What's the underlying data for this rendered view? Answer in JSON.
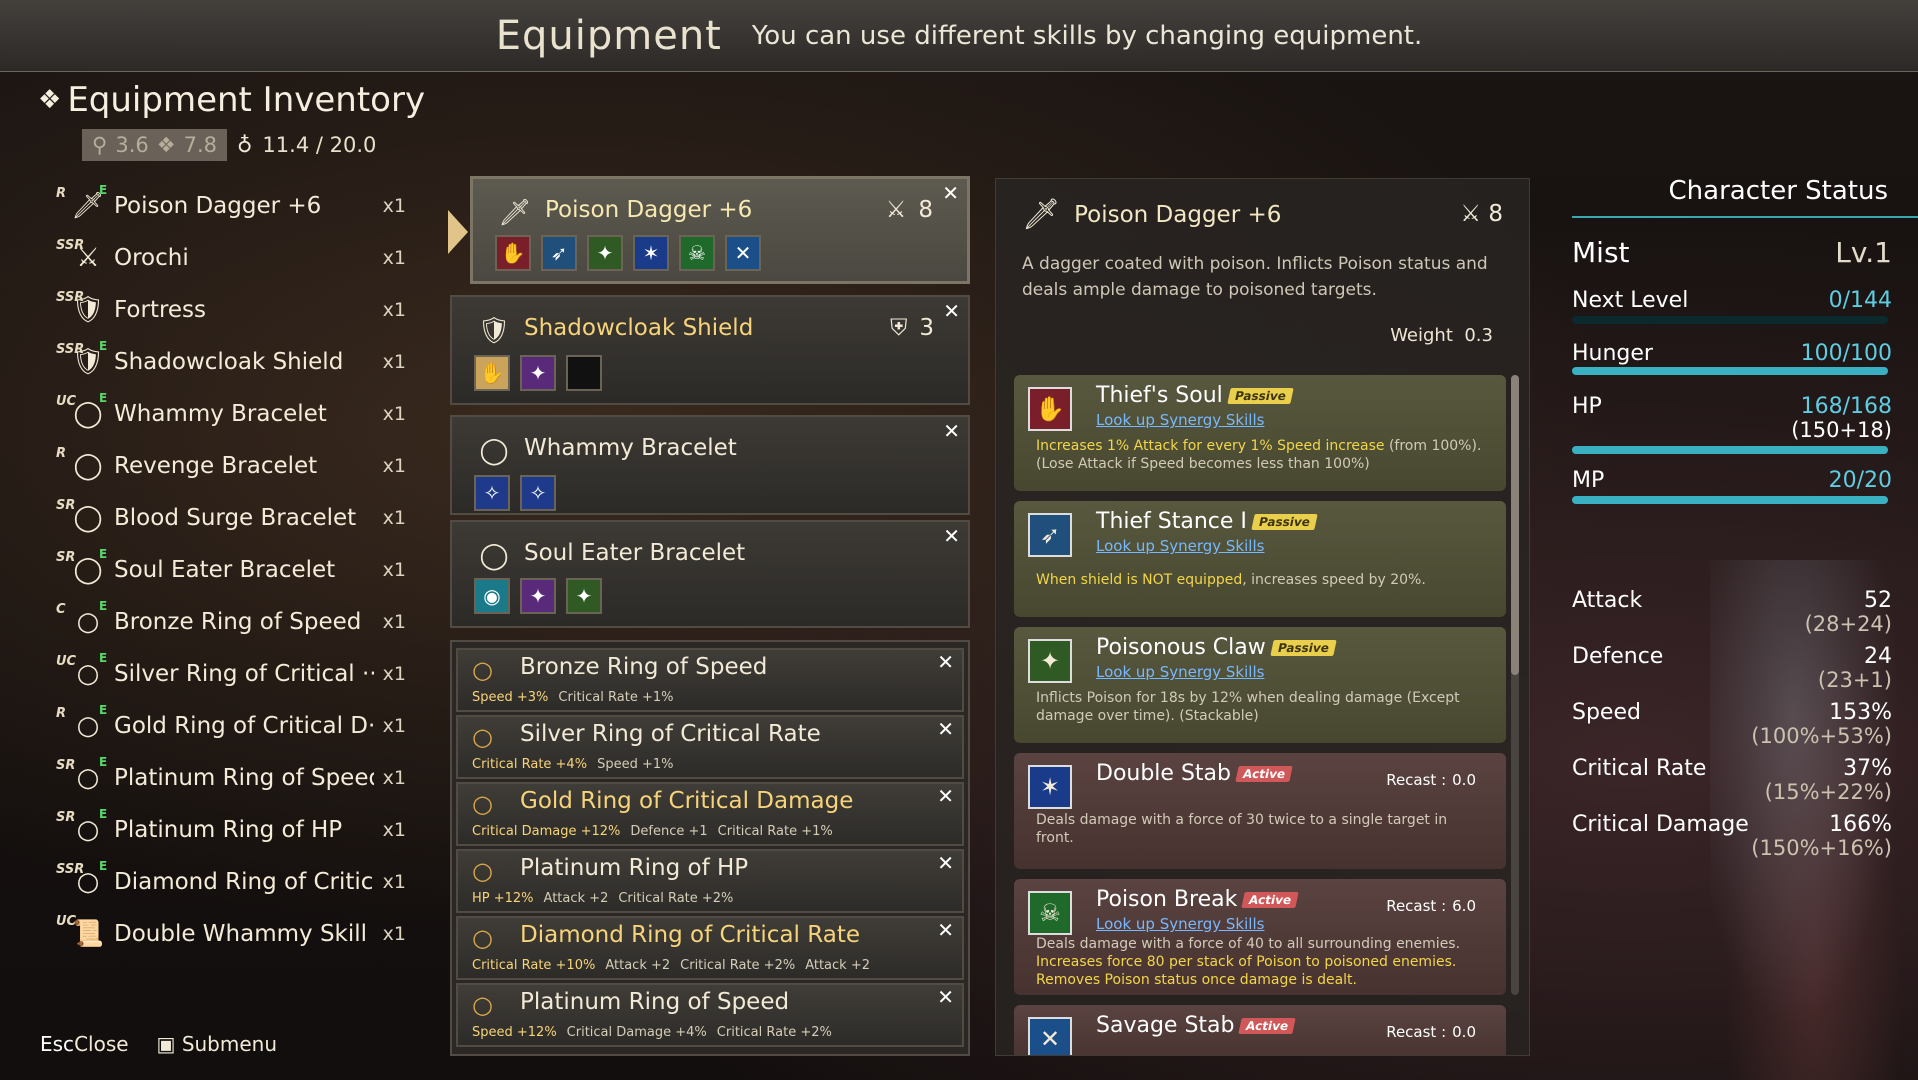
{
  "header": {
    "title": "Equipment",
    "subtitle": "You can use different skills by changing equipment."
  },
  "inventory": {
    "title": "Equipment Inventory",
    "stat_a": "3.6",
    "stat_b": "7.8",
    "weight": "11.4 / 20.0",
    "items": [
      {
        "rarity": "R",
        "equipped": "E",
        "icon": "dagger-icon",
        "glyph": "🗡",
        "name": "Poison Dagger +6",
        "qty": "x1"
      },
      {
        "rarity": "SSR",
        "equipped": "",
        "icon": "sword-icon",
        "glyph": "⚔",
        "name": "Orochi",
        "qty": "x1"
      },
      {
        "rarity": "SSR",
        "equipped": "",
        "icon": "shield-icon",
        "glyph": "🛡",
        "name": "Fortress",
        "qty": "x1"
      },
      {
        "rarity": "SSR",
        "equipped": "E",
        "icon": "shield-icon",
        "glyph": "🛡",
        "name": "Shadowcloak Shield",
        "qty": "x1"
      },
      {
        "rarity": "UC",
        "equipped": "E",
        "icon": "bracelet-icon",
        "glyph": "◯",
        "name": "Whammy Bracelet",
        "qty": "x1"
      },
      {
        "rarity": "R",
        "equipped": "",
        "icon": "bracelet-icon",
        "glyph": "◯",
        "name": "Revenge Bracelet",
        "qty": "x1"
      },
      {
        "rarity": "SR",
        "equipped": "",
        "icon": "bracelet-icon",
        "glyph": "◯",
        "name": "Blood Surge Bracelet",
        "qty": "x1"
      },
      {
        "rarity": "SR",
        "equipped": "E",
        "icon": "bracelet-icon",
        "glyph": "◯",
        "name": "Soul Eater Bracelet",
        "qty": "x1"
      },
      {
        "rarity": "C",
        "equipped": "E",
        "icon": "ring-icon",
        "glyph": "○",
        "name": "Bronze Ring of Speed",
        "qty": "x1"
      },
      {
        "rarity": "UC",
        "equipped": "E",
        "icon": "ring-icon",
        "glyph": "○",
        "name": "Silver Ring of Critical ···",
        "qty": "x1"
      },
      {
        "rarity": "R",
        "equipped": "E",
        "icon": "ring-icon",
        "glyph": "○",
        "name": "Gold Ring of Critical D···",
        "qty": "x1"
      },
      {
        "rarity": "SR",
        "equipped": "E",
        "icon": "ring-icon",
        "glyph": "○",
        "name": "Platinum Ring of Speed",
        "qty": "x1"
      },
      {
        "rarity": "SR",
        "equipped": "E",
        "icon": "ring-icon",
        "glyph": "○",
        "name": "Platinum Ring of HP",
        "qty": "x1"
      },
      {
        "rarity": "SSR",
        "equipped": "E",
        "icon": "ring-icon",
        "glyph": "○",
        "name": "Diamond Ring of Critic···",
        "qty": "x1"
      },
      {
        "rarity": "UC",
        "equipped": "",
        "icon": "scroll-icon",
        "glyph": "📜",
        "name": "Double Whammy Skill ···",
        "qty": "x1"
      }
    ]
  },
  "footer": {
    "close_key": "Esc",
    "close_label": "Close",
    "submenu_label": "Submenu"
  },
  "equipped": {
    "weapon": {
      "name": "Poison Dagger +6",
      "power": "8"
    },
    "shield": {
      "name": "Shadowcloak Shield",
      "defence": "3"
    },
    "bracelet1": {
      "name": "Whammy Bracelet"
    },
    "bracelet2": {
      "name": "Soul Eater Bracelet"
    },
    "rings": [
      {
        "name": "Bronze Ring of Speed",
        "gold": false,
        "desc": [
          [
            "Speed +3%",
            true
          ],
          [
            "Critical Rate +1%",
            false
          ]
        ]
      },
      {
        "name": "Silver Ring of Critical Rate",
        "gold": false,
        "desc": [
          [
            "Critical Rate +4%",
            true
          ],
          [
            "Speed +1%",
            false
          ]
        ]
      },
      {
        "name": "Gold Ring of Critical Damage",
        "gold": true,
        "desc": [
          [
            "Critical Damage +12%",
            true
          ],
          [
            "Defence +1",
            false
          ],
          [
            "Critical Rate +1%",
            false
          ]
        ]
      },
      {
        "name": "Platinum Ring of HP",
        "gold": false,
        "desc": [
          [
            "HP +12%",
            true
          ],
          [
            "Attack +2",
            false
          ],
          [
            "Critical Rate +2%",
            false
          ]
        ]
      },
      {
        "name": "Diamond Ring of Critical Rate",
        "gold": true,
        "desc": [
          [
            "Critical Rate +10%",
            true
          ],
          [
            "Attack +2",
            false
          ],
          [
            "Critical Rate +2%",
            false
          ],
          [
            "Attack +2",
            false
          ]
        ]
      },
      {
        "name": "Platinum Ring of Speed",
        "gold": false,
        "desc": [
          [
            "Speed +12%",
            true
          ],
          [
            "Critical Damage +4%",
            false
          ],
          [
            "Critical Rate +2%",
            false
          ]
        ]
      }
    ]
  },
  "detail": {
    "name": "Poison Dagger +6",
    "power": "8",
    "description": "A dagger coated with poison. Inflicts Poison status and deals ample damage to poisoned targets.",
    "weight_label": "Weight",
    "weight": "0.3",
    "link_label": "Look up Synergy Skills",
    "recast_label": "Recast :",
    "skills": [
      {
        "name": "Thief's Soul",
        "type": "Passive",
        "link": true,
        "recast": "",
        "desc_hl": "Increases 1% Attack for every 1% Speed increase",
        "desc": " (from 100%). (Lose Attack if Speed becomes less than 100%)"
      },
      {
        "name": "Thief Stance I",
        "type": "Passive",
        "link": true,
        "recast": "",
        "desc_hl": "When shield is NOT equipped",
        "desc": ", increases speed by 20%."
      },
      {
        "name": "Poisonous Claw",
        "type": "Passive",
        "link": true,
        "recast": "",
        "desc_hl": "",
        "desc": "Inflicts Poison for 18s by 12% when dealing damage (Except damage over time). (Stackable)"
      },
      {
        "name": "Double Stab",
        "type": "Active",
        "link": false,
        "recast": "0.0",
        "desc_hl": "",
        "desc": "Deals damage with a force of 30 twice to a single target in front."
      },
      {
        "name": "Poison Break",
        "type": "Active",
        "link": true,
        "recast": "6.0",
        "desc_pre": "Deals damage with a force of 40 to all surrounding enemies.",
        "desc_hl": "Increases force 80 per stack of Poison to poisoned enemies. Removes Poison status once damage is dealt.",
        "desc": ""
      },
      {
        "name": "Savage Stab",
        "type": "Active",
        "link": false,
        "recast": "0.0",
        "desc_hl": "",
        "desc": ""
      }
    ]
  },
  "status": {
    "title": "Character Status",
    "name": "Mist",
    "level": "Lv.1",
    "next_level_label": "Next Level",
    "next_level": "0/144",
    "hunger_label": "Hunger",
    "hunger": "100/100",
    "hunger_fraction": 1.0,
    "hp_label": "HP",
    "hp": "168/168",
    "hp_sub": "(150+18)",
    "hp_fraction": 1.0,
    "mp_label": "MP",
    "mp": "20/20",
    "mp_fraction": 1.0,
    "stats": [
      {
        "label": "Attack",
        "value": "52",
        "sub": "(28+24)"
      },
      {
        "label": "Defence",
        "value": "24",
        "sub": "(23+1)"
      },
      {
        "label": "Speed",
        "value": "153%",
        "sub": "(100%+53%)"
      },
      {
        "label": "Critical Rate",
        "value": "37%",
        "sub": "(15%+22%)"
      },
      {
        "label": "Critical Damage",
        "value": "166%",
        "sub": "(150%+16%)"
      }
    ]
  },
  "colors": {
    "accent": "#39b1c2",
    "gold": "#f7d47a",
    "passive": "#e9cf4c",
    "active": "#d05858"
  }
}
